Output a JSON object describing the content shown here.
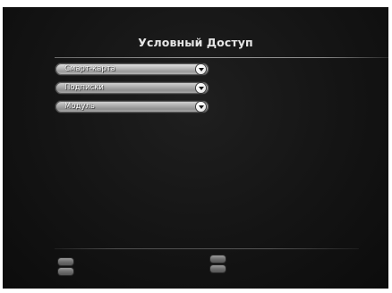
{
  "screen": {
    "title": "Условный Доступ"
  },
  "menu": {
    "items": [
      {
        "label": "Смарт-карта",
        "icon": "chevron-down-icon",
        "selected": true
      },
      {
        "label": "Подписки",
        "icon": "chevron-down-icon",
        "selected": false
      },
      {
        "label": "Модуль",
        "icon": "chevron-down-icon",
        "selected": false
      }
    ]
  },
  "footer": {
    "hint_keys": [
      {
        "icon": "color-key-icon"
      },
      {
        "icon": "color-key-icon"
      }
    ]
  }
}
